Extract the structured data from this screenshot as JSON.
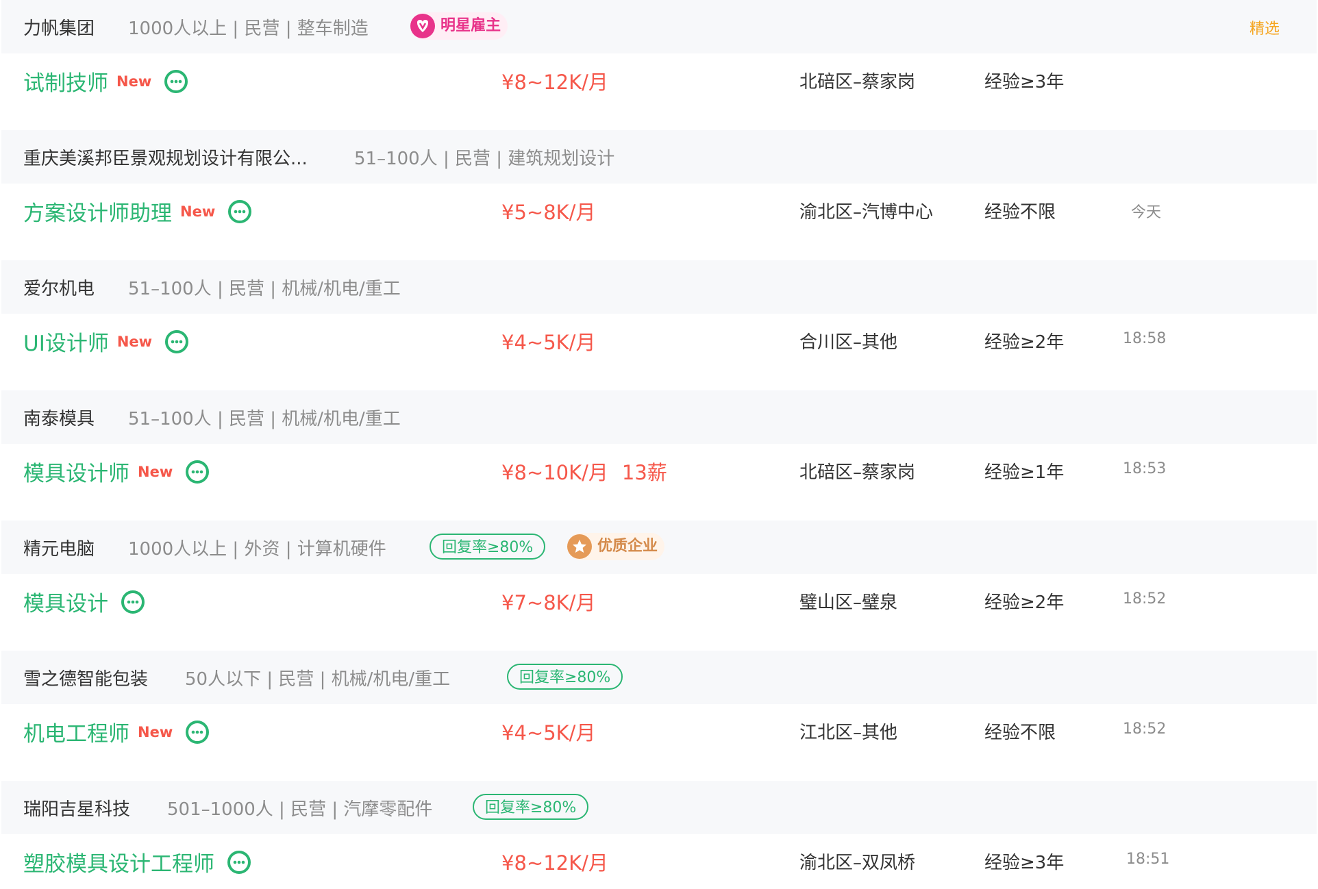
{
  "listings": [
    {
      "company": "力帆集团",
      "meta": "1000人以上 | 民营 | 整车制造",
      "star_badge": "明星雇主",
      "featured": "精选",
      "title": "试制技师",
      "new": "New",
      "salary": "¥8~12K/月",
      "location": "北碚区–蔡家岗",
      "experience": "经验≥3年"
    },
    {
      "company": "重庆美溪邦臣景观规划设计有限公...",
      "meta": "51–100人 | 民营 | 建筑规划设计",
      "title": "方案设计师助理",
      "new": "New",
      "salary": "¥5~8K/月",
      "location": "渝北区–汽博中心",
      "experience": "经验不限",
      "time": "今天"
    },
    {
      "company": "爱尔机电",
      "meta": "51–100人 | 民营 | 机械/机电/重工",
      "title": "UI设计师",
      "new": "New",
      "salary": "¥4~5K/月",
      "location": "合川区–其他",
      "experience": "经验≥2年",
      "time": "18:58"
    },
    {
      "company": "南泰模具",
      "meta": "51–100人 | 民营 | 机械/机电/重工",
      "title": "模具设计师",
      "new": "New",
      "salary": "¥8~10K/月",
      "bonus": "13薪",
      "location": "北碚区–蔡家岗",
      "experience": "经验≥1年",
      "time": "18:53"
    },
    {
      "company": "精元电脑",
      "meta": "1000人以上 | 外资 | 计算机硬件",
      "reply_badge": "回复率≥80%",
      "quality_badge": "优质企业",
      "title": "模具设计",
      "salary": "¥7~8K/月",
      "location": "璧山区–璧泉",
      "experience": "经验≥2年",
      "time": "18:52"
    },
    {
      "company": "雪之德智能包装",
      "meta": "50人以下 | 民营 | 机械/机电/重工",
      "reply_badge": "回复率≥80%",
      "title": "机电工程师",
      "new": "New",
      "salary": "¥4~5K/月",
      "location": "江北区–其他",
      "experience": "经验不限",
      "time": "18:52"
    },
    {
      "company": "瑞阳吉星科技",
      "meta": "501–1000人 | 民营 | 汽摩零配件",
      "reply_badge": "回复率≥80%",
      "title": "塑胶模具设计工程师",
      "salary": "¥8~12K/月",
      "location": "渝北区–双凤桥",
      "experience": "经验≥3年",
      "time": "18:51"
    }
  ],
  "colors": {
    "accent_green": "#2bb673",
    "salary_red": "#f5574a",
    "featured_orange": "#f5a623",
    "star_pink": "#e8338a",
    "quality_orange": "#e59a57"
  },
  "icons": {
    "chat": "chat-bubble-icon",
    "star_employer": "heart-v-icon",
    "quality": "star-icon"
  }
}
